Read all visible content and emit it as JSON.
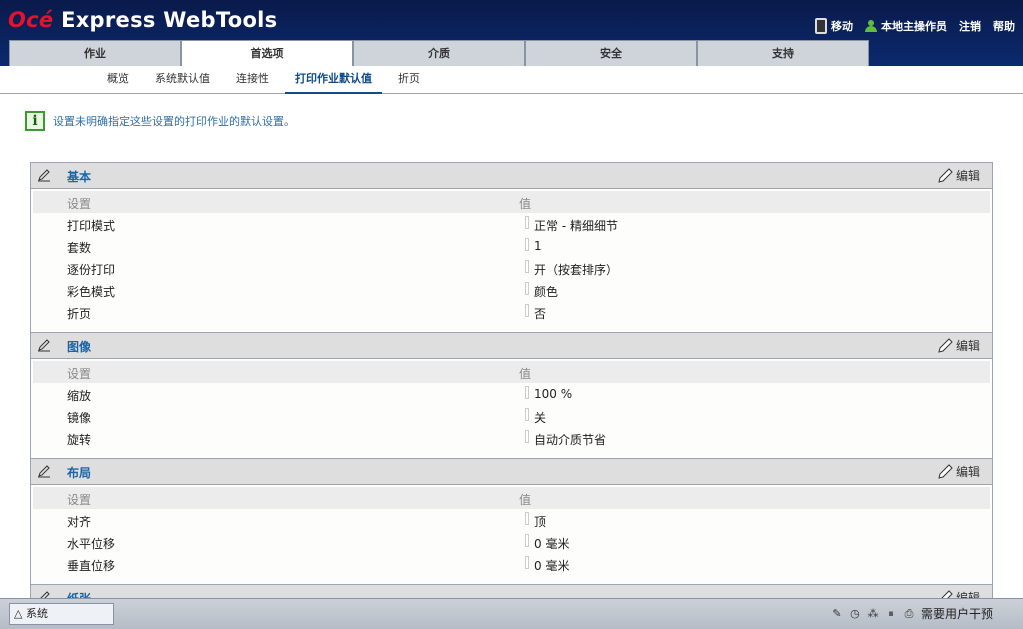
{
  "app": {
    "brand_red": "Océ",
    "brand_white": " Express WebTools"
  },
  "top_actions": {
    "mobile": "移动",
    "user": "本地主操作员",
    "logout": "注销",
    "help": "帮助"
  },
  "tabs": [
    {
      "label": "作业"
    },
    {
      "label": "首选项"
    },
    {
      "label": "介质"
    },
    {
      "label": "安全"
    },
    {
      "label": "支持"
    }
  ],
  "subnav": [
    {
      "label": "概览"
    },
    {
      "label": "系统默认值"
    },
    {
      "label": "连接性"
    },
    {
      "label": "打印作业默认值"
    },
    {
      "label": "折页"
    }
  ],
  "info_text": "设置未明确指定这些设置的打印作业的默认设置。",
  "edit_label": "编辑",
  "col_setting": "设置",
  "col_value": "值",
  "sections": [
    {
      "title": "基本",
      "rows": [
        {
          "k": "打印模式",
          "v": "正常 - 精细细节"
        },
        {
          "k": "套数",
          "v": "1"
        },
        {
          "k": "逐份打印",
          "v": "开（按套排序）"
        },
        {
          "k": "彩色模式",
          "v": "颜色"
        },
        {
          "k": "折页",
          "v": "否"
        }
      ]
    },
    {
      "title": "图像",
      "rows": [
        {
          "k": "缩放",
          "v": "100 %"
        },
        {
          "k": "镜像",
          "v": "关"
        },
        {
          "k": "旋转",
          "v": "自动介质节省"
        }
      ]
    },
    {
      "title": "布局",
      "rows": [
        {
          "k": "对齐",
          "v": "顶"
        },
        {
          "k": "水平位移",
          "v": "0 毫米"
        },
        {
          "k": "垂直位移",
          "v": "0 毫米"
        }
      ]
    },
    {
      "title": "纸张",
      "rows": []
    }
  ],
  "bottom": {
    "system_tab": "△ 系统",
    "status": "需要用户干预"
  },
  "colors": {
    "header_bg": "#0b2a6e",
    "accent_blue": "#1b63a8",
    "brand_red": "#e8112d"
  }
}
